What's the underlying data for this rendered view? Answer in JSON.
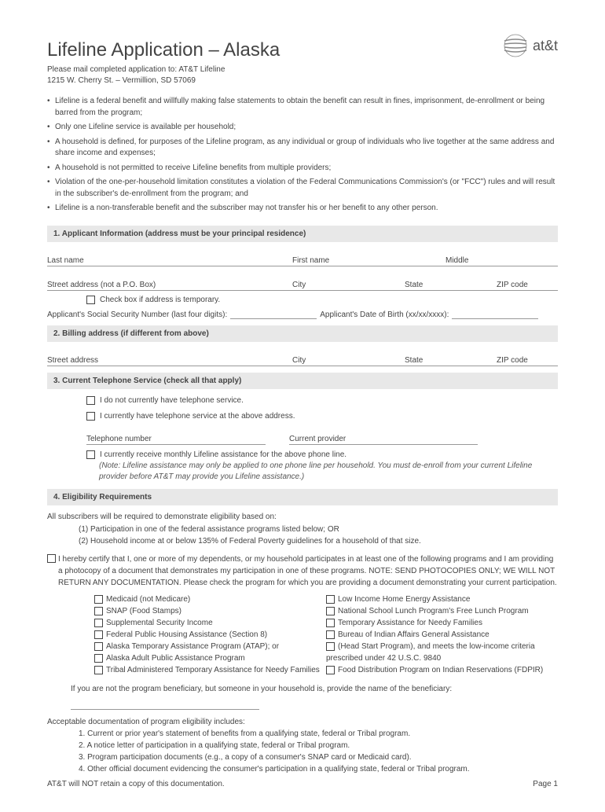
{
  "title": "Lifeline Application – Alaska",
  "mailto_line1": "Please mail completed application to: AT&T Lifeline",
  "mailto_line2": "1215 W. Cherry St. – Vermillion, SD 57069",
  "brand": "at&t",
  "bullets": [
    "Lifeline is a federal benefit and willfully making false statements to obtain the benefit can result in fines, imprisonment, de-enrollment or being barred from the program;",
    "Only one Lifeline service is available per household;",
    "A household is defined, for purposes of the Lifeline program, as any individual or group of individuals who live together at the same address and share income and expenses;",
    "A household is not permitted to receive Lifeline benefits from multiple providers;",
    "Violation of the one-per-household limitation constitutes a violation of the Federal Communications Commission's (or \"FCC\") rules and will result in the subscriber's de-enrollment from the program; and",
    "Lifeline is a non-transferable benefit and the subscriber may not transfer his or her benefit to any other person."
  ],
  "section1": "1. Applicant Information (address must be your principal residence)",
  "fields": {
    "last": "Last name",
    "first": "First name",
    "middle": "Middle",
    "street1": "Street address (not a P.O. Box)",
    "city": "City",
    "state": "State",
    "zip": "ZIP code",
    "temp_check": "Check box if address is temporary.",
    "ssn": "Applicant's Social Security Number (last four digits):",
    "dob": "Applicant's Date of Birth (xx/xx/xxxx):"
  },
  "section2": "2. Billing address (if different from above)",
  "fields2": {
    "street": "Street address",
    "city": "City",
    "state": "State",
    "zip": "ZIP code"
  },
  "section3": "3. Current Telephone Service (check all that apply)",
  "tel": {
    "opt1": "I do not currently have telephone service.",
    "opt2": "I currently have telephone service at the above address.",
    "num": "Telephone number",
    "prov": "Current provider",
    "opt3": "I currently receive monthly Lifeline assistance for the above phone line.",
    "note": "(Note: Lifeline assistance may only be applied to one phone line per household. You must de-enroll from your current Lifeline provider before AT&T may provide you Lifeline assistance.)"
  },
  "section4": "4. Eligibility Requirements",
  "elig": {
    "intro": "All subscribers will be required to demonstrate eligibility based on:",
    "sub1": "(1) Participation in one of the federal assistance programs listed below; OR",
    "sub2": "(2) Household income at or below 135% of Federal Poverty guidelines for a household of that size.",
    "cert": "I hereby certify that I, one or more of my dependents, or my household participates in at least one of the following programs and I am providing a photocopy of a document that demonstrates my participation in one of these programs. NOTE: SEND PHOTOCOPIES ONLY; WE WILL NOT RETURN ANY DOCUMENTATION. Please check the program for which you are providing a document demonstrating your current participation."
  },
  "programs_left": [
    "Medicaid (not Medicare)",
    "SNAP (Food Stamps)",
    "Supplemental Security Income",
    "Federal Public Housing Assistance (Section 8)",
    "Alaska Temporary Assistance Program (ATAP); or",
    "Alaska Adult Public Assistance Program",
    "Tribal Administered Temporary Assistance for Needy Families"
  ],
  "programs_right": [
    "Low Income Home Energy Assistance",
    "National School Lunch Program's Free Lunch Program",
    "Temporary Assistance for Needy Families",
    "Bureau of Indian Affairs General Assistance",
    "(Head Start Program), and meets the low-income criteria prescribed under 42 U.S.C. 9840",
    "Food Distribution Program on Indian Reservations (FDPIR)"
  ],
  "benef": "If you are not the program beneficiary, but someone in your household is, provide the name of the beneficiary:",
  "accept": "Acceptable documentation of program eligibility includes:",
  "accept_items": [
    "1. Current or prior year's statement of benefits from a qualifying state, federal or Tribal program.",
    "2. A notice letter of participation in a qualifying state, federal or Tribal program.",
    "3. Program participation documents (e.g., a copy of a consumer's SNAP card or Medicaid card).",
    "4. Other official document evidencing the consumer's participation in a qualifying state, federal or Tribal program."
  ],
  "retain": "AT&T will NOT retain a copy of this documentation.",
  "pagenum": "Page 1"
}
